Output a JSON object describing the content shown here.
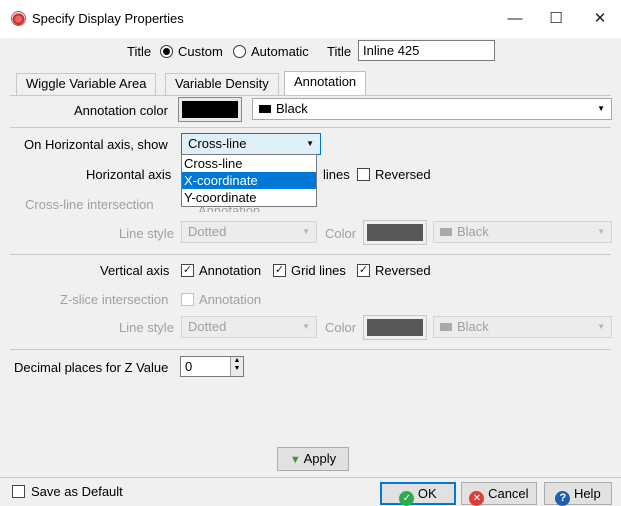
{
  "window": {
    "title": "Specify Display Properties",
    "minimize_glyph": "—",
    "maximize_glyph": "☐",
    "close_glyph": "✕"
  },
  "title_row": {
    "label": "Title",
    "option_custom": "Custom",
    "option_automatic": "Automatic",
    "selected": "Custom",
    "title_label": "Title",
    "title_value": "Inline 425"
  },
  "tabs": [
    {
      "label": "Wiggle Variable Area",
      "active": false
    },
    {
      "label": "Variable Density",
      "active": false
    },
    {
      "label": "Annotation",
      "active": true
    }
  ],
  "annotation": {
    "color_label": "Annotation color",
    "color_value": "Black",
    "color_hex": "#000000"
  },
  "horizontal": {
    "show_label": "On Horizontal axis, show",
    "show_value": "Cross-line",
    "dropdown_options": [
      "Cross-line",
      "X-coordinate",
      "Y-coordinate"
    ],
    "highlighted_option": "X-coordinate",
    "axis_label": "Horizontal axis",
    "grid_lines_partial": "lines",
    "reversed_label": "Reversed",
    "reversed_checked": false,
    "intersection_label": "Cross-line intersection",
    "intersection_annotation_partial": "Annotation",
    "line_style_label": "Line style",
    "line_style_value": "Dotted",
    "color_label": "Color",
    "color_value": "Black"
  },
  "vertical": {
    "axis_label": "Vertical axis",
    "annotation_label": "Annotation",
    "annotation_checked": true,
    "grid_lines_label": "Grid lines",
    "grid_lines_checked": true,
    "reversed_label": "Reversed",
    "reversed_checked": true,
    "intersection_label": "Z-slice intersection",
    "intersection_annotation_label": "Annotation",
    "intersection_annotation_checked": false,
    "line_style_label": "Line style",
    "line_style_value": "Dotted",
    "color_label": "Color",
    "color_value": "Black"
  },
  "decimal": {
    "label": "Decimal places for Z Value",
    "value": "0"
  },
  "footer": {
    "apply_label": "Apply",
    "save_default_label": "Save as Default",
    "save_default_checked": false,
    "ok_label": "OK",
    "cancel_label": "Cancel",
    "help_label": "Help"
  },
  "colors": {
    "accent": "#0078d7",
    "ok_green": "#2eaa4f",
    "cancel_red": "#d9403a",
    "help_blue": "#1f5fb0",
    "apply_green": "#3a9a2a"
  }
}
